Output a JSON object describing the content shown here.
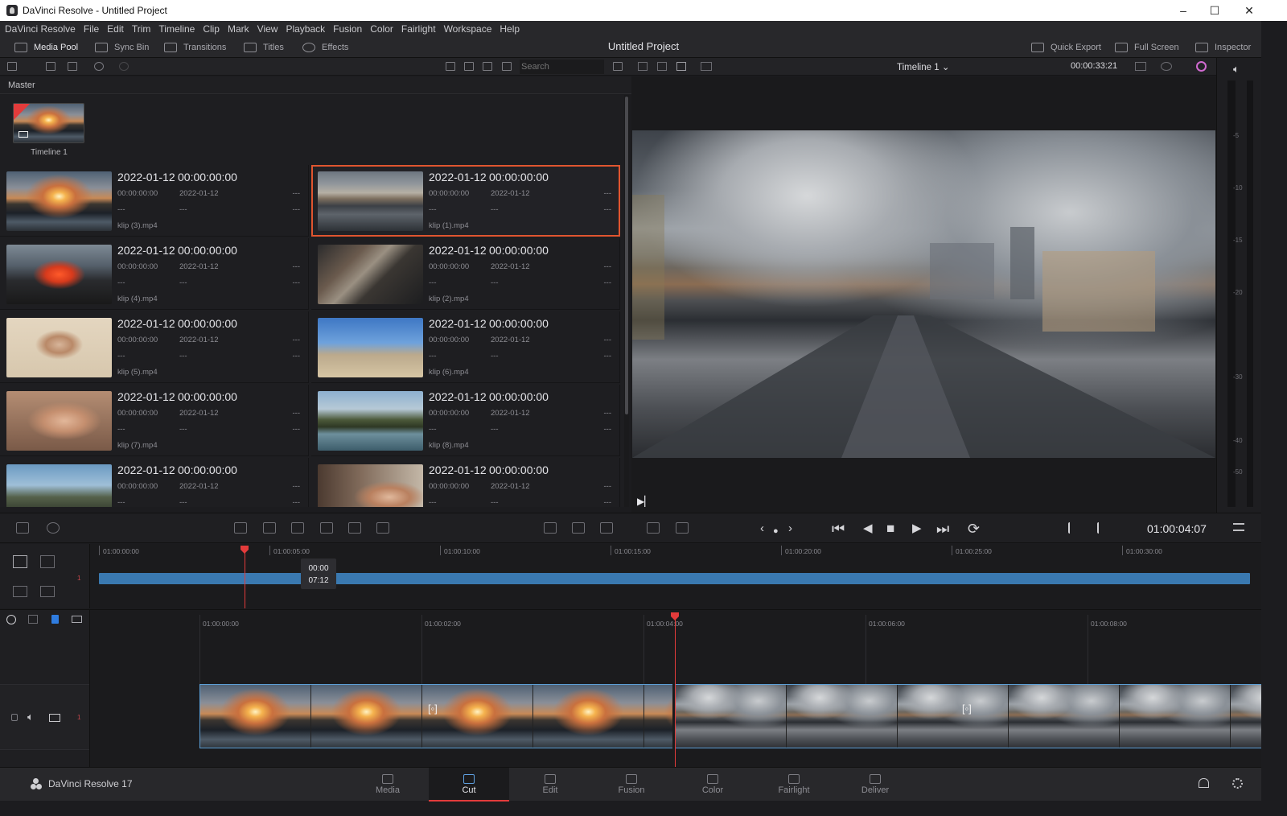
{
  "window": {
    "title": "DaVinci Resolve - Untitled Project",
    "minimize": "–",
    "maximize": "☐",
    "close": "✕"
  },
  "menu": [
    "DaVinci Resolve",
    "File",
    "Edit",
    "Trim",
    "Timeline",
    "Clip",
    "Mark",
    "View",
    "Playback",
    "Fusion",
    "Color",
    "Fairlight",
    "Workspace",
    "Help"
  ],
  "toolbar": {
    "media_pool": "Media Pool",
    "sync_bin": "Sync Bin",
    "transitions": "Transitions",
    "titles": "Titles",
    "effects": "Effects",
    "project_title": "Untitled Project",
    "quick_export": "Quick Export",
    "full_screen": "Full Screen",
    "inspector": "Inspector"
  },
  "media_pool": {
    "search_placeholder": "Search",
    "bin": "Master",
    "timeline_label": "Timeline 1",
    "clips": [
      {
        "date": "2022-01-12",
        "tc": "00:00:00:00",
        "start": "00:00:00:00",
        "mod": "2022-01-12",
        "d1": "---",
        "d2": "---",
        "d3": "---",
        "d4": "---",
        "file": "klip (3).mp4",
        "img": "sunset"
      },
      {
        "date": "2022-01-12",
        "tc": "00:00:00:00",
        "start": "00:00:00:00",
        "mod": "2022-01-12",
        "d1": "---",
        "d2": "---",
        "d3": "---",
        "d4": "---",
        "file": "klip (1).mp4",
        "img": "city"
      },
      {
        "date": "2022-01-12",
        "tc": "00:00:00:00",
        "start": "00:00:00:00",
        "mod": "2022-01-12",
        "d1": "---",
        "d2": "---",
        "d3": "---",
        "d4": "---",
        "file": "klip (4).mp4",
        "img": "lava"
      },
      {
        "date": "2022-01-12",
        "tc": "00:00:00:00",
        "start": "00:00:00:00",
        "mod": "2022-01-12",
        "d1": "---",
        "d2": "---",
        "d3": "---",
        "d4": "---",
        "file": "klip (2).mp4",
        "img": "aerial"
      },
      {
        "date": "2022-01-12",
        "tc": "00:00:00:00",
        "start": "00:00:00:00",
        "mod": "2022-01-12",
        "d1": "---",
        "d2": "---",
        "d3": "---",
        "d4": "---",
        "file": "klip (5).mp4",
        "img": "woman"
      },
      {
        "date": "2022-01-12",
        "tc": "00:00:00:00",
        "start": "00:00:00:00",
        "mod": "2022-01-12",
        "d1": "---",
        "d2": "---",
        "d3": "---",
        "d4": "---",
        "file": "klip (6).mp4",
        "img": "beach"
      },
      {
        "date": "2022-01-12",
        "tc": "00:00:00:00",
        "start": "00:00:00:00",
        "mod": "2022-01-12",
        "d1": "---",
        "d2": "---",
        "d3": "---",
        "d4": "---",
        "file": "klip (7).mp4",
        "img": "face"
      },
      {
        "date": "2022-01-12",
        "tc": "00:00:00:00",
        "start": "00:00:00:00",
        "mod": "2022-01-12",
        "d1": "---",
        "d2": "---",
        "d3": "---",
        "d4": "---",
        "file": "klip (8).mp4",
        "img": "coast"
      },
      {
        "date": "2022-01-12",
        "tc": "00:00:00:00",
        "start": "00:00:00:00",
        "mod": "2022-01-12",
        "d1": "---",
        "d2": "---",
        "d3": "---",
        "d4": "---",
        "file": "",
        "img": "mount"
      },
      {
        "date": "2022-01-12",
        "tc": "00:00:00:00",
        "start": "00:00:00:00",
        "mod": "2022-01-12",
        "d1": "---",
        "d2": "---",
        "d3": "---",
        "d4": "---",
        "file": "",
        "img": "xmas"
      }
    ],
    "selected_index": 1
  },
  "viewer": {
    "timeline_name": "Timeline 1",
    "source_tc": "00:00:33:21",
    "playhead_tc": "01:00:04:07",
    "dropdown": "⌄"
  },
  "meter": {
    "labels": [
      "-5",
      "-10",
      "-15",
      "-20",
      "-30",
      "-40",
      "-50"
    ]
  },
  "transport": {
    "prev": "⏮",
    "back": "◀",
    "stop": "■",
    "play": "▶",
    "next": "⏭",
    "loop": "⟳",
    "nav_left": "‹",
    "nav_dot": "●",
    "nav_right": "›"
  },
  "upper_timeline": {
    "ruler": [
      "01:00:00:00",
      "01:00:05:00",
      "01:00:10:00",
      "01:00:15:00",
      "01:00:20:00",
      "01:00:25:00",
      "01:00:30:00"
    ],
    "tooltip_line1": "00:00",
    "tooltip_line2": "07:12",
    "track_number": "1"
  },
  "lower_timeline": {
    "ruler": [
      "01:00:00:00",
      "01:00:02:00",
      "01:00:04:00",
      "01:00:06:00",
      "01:00:08:00"
    ],
    "track_number": "1",
    "transition_marker": "[◦]"
  },
  "pages": [
    "Media",
    "Cut",
    "Edit",
    "Fusion",
    "Color",
    "Fairlight",
    "Deliver"
  ],
  "active_page": "Cut",
  "brand": "DaVinci Resolve 17",
  "colors": {
    "accent": "#e33b3b",
    "selection": "#e0552f",
    "clip_blue": "#3a79b0"
  }
}
